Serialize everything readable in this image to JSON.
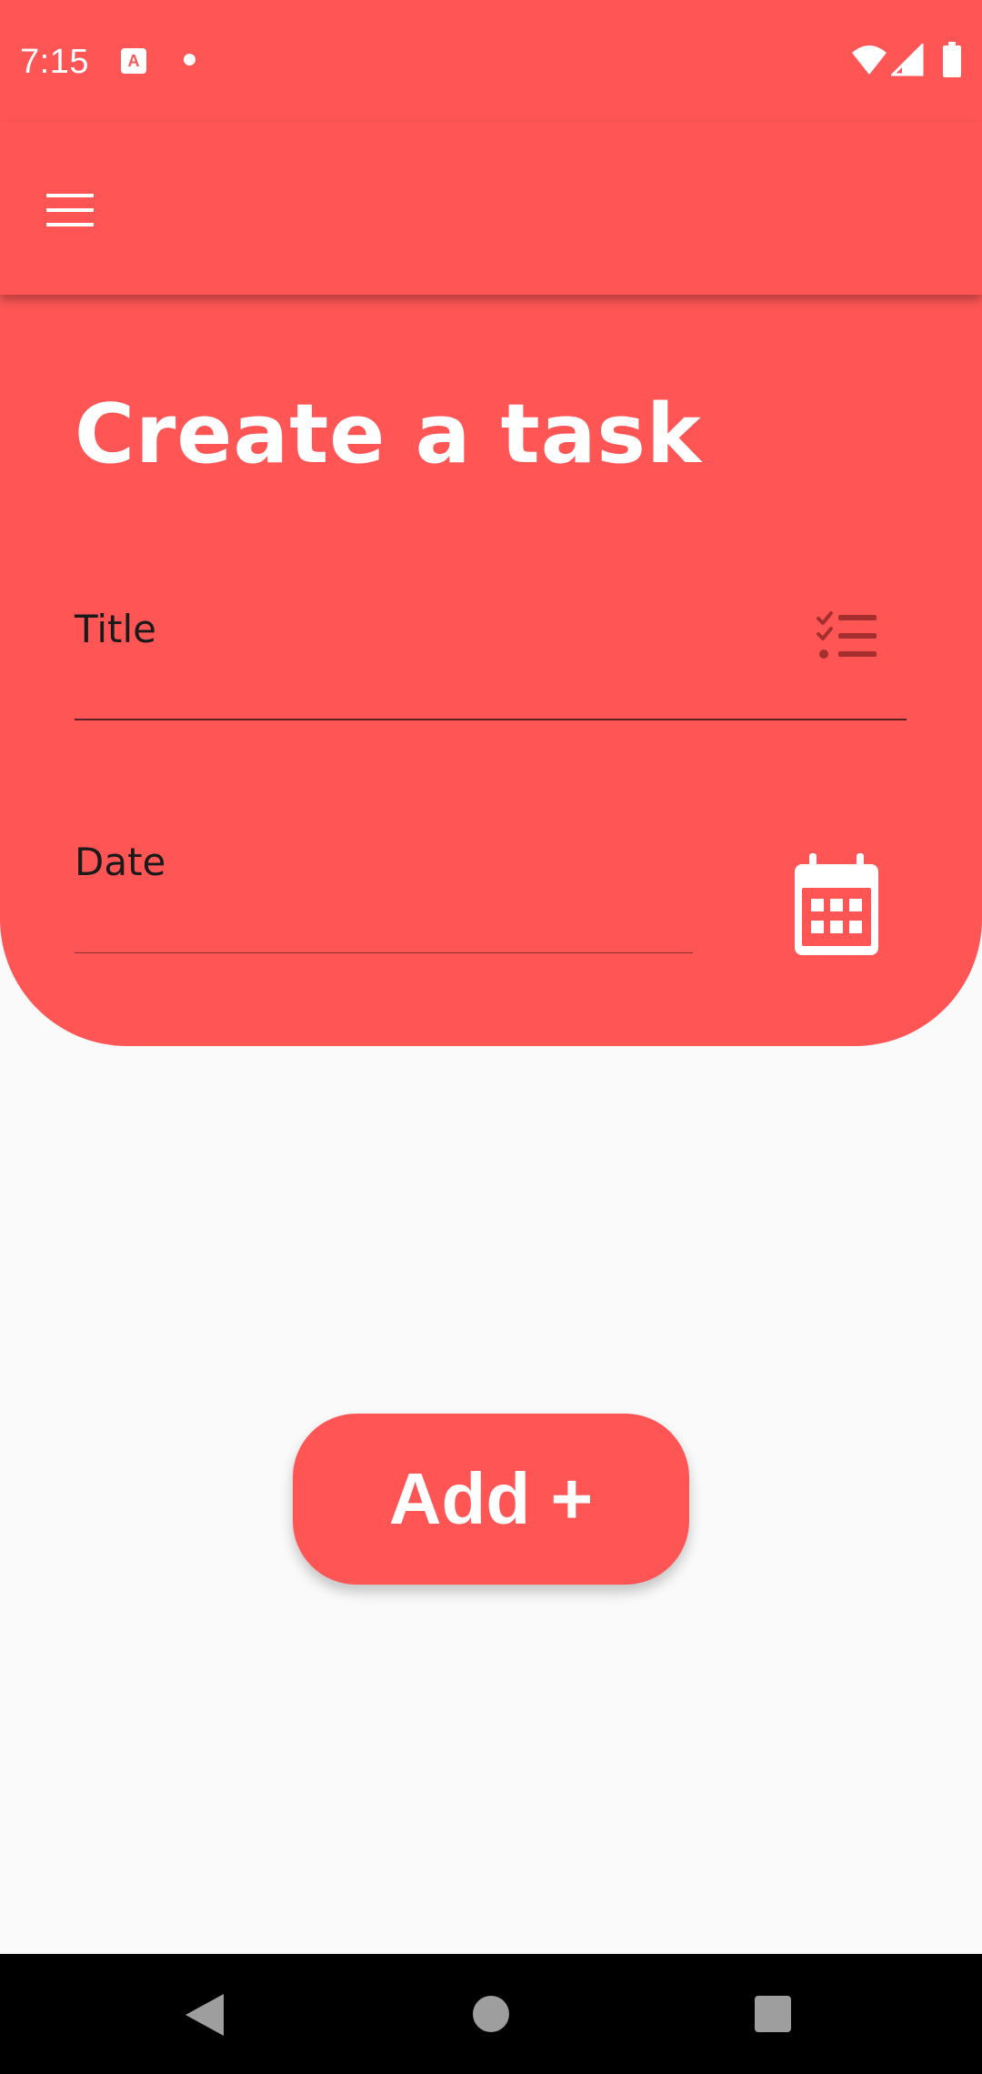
{
  "status_bar": {
    "time": "7:15",
    "icons": [
      "notification-a-icon",
      "dot-icon",
      "wifi-icon",
      "cell-signal-icon",
      "battery-icon"
    ]
  },
  "app_bar": {
    "menu_icon": "hamburger-menu-icon"
  },
  "form": {
    "title": "Create a task",
    "title_field": {
      "label": "Title",
      "value": "",
      "icon": "checklist-icon"
    },
    "date_field": {
      "label": "Date",
      "value": "",
      "icon": "calendar-icon"
    }
  },
  "actions": {
    "add_label": "Add +"
  },
  "nav_bar": {
    "buttons": [
      "back",
      "home",
      "recents"
    ]
  },
  "colors": {
    "primary": "#ff5555",
    "background": "#fafafa",
    "icon_dark": "#a52e2e",
    "nav_background": "#000000"
  }
}
